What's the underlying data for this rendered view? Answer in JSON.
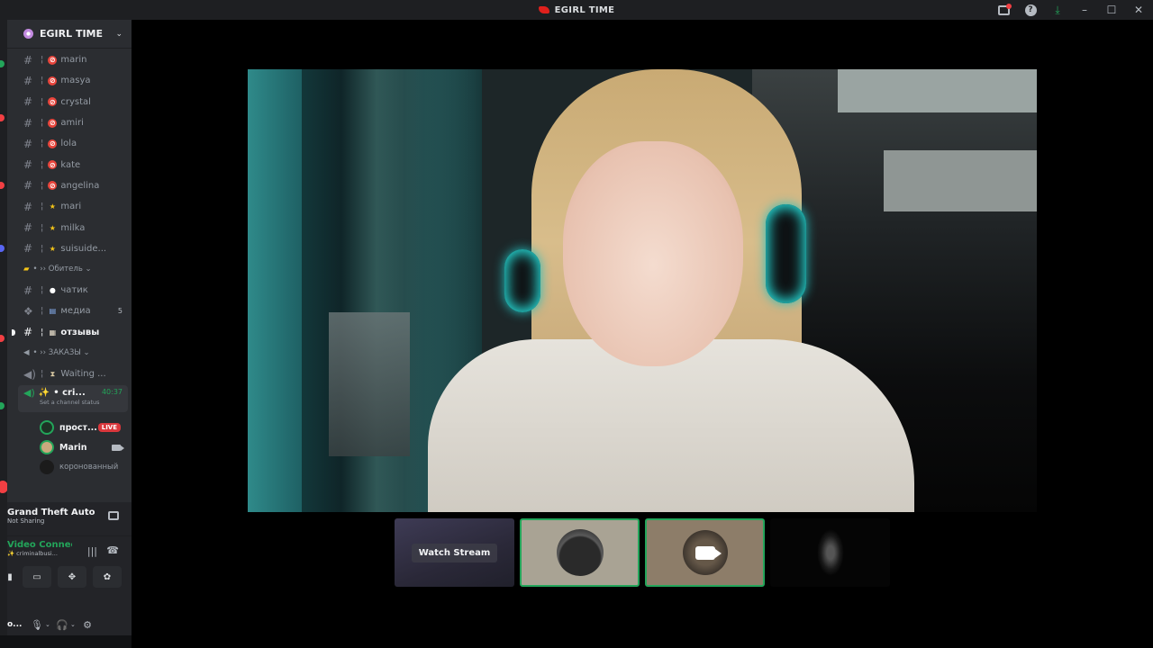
{
  "titlebar": {
    "title": "EGIRL TIME",
    "icons": [
      "inbox-icon",
      "help-icon",
      "download-icon",
      "minimize-icon",
      "maximize-icon",
      "close-icon"
    ]
  },
  "server": {
    "name": "EGIRL TIME"
  },
  "channels": [
    {
      "label": "marin",
      "emoji": "no-entry"
    },
    {
      "label": "masya",
      "emoji": "no-entry"
    },
    {
      "label": "crystal",
      "emoji": "no-entry"
    },
    {
      "label": "amiri",
      "emoji": "no-entry"
    },
    {
      "label": "lola",
      "emoji": "no-entry"
    },
    {
      "label": "kate",
      "emoji": "no-entry"
    },
    {
      "label": "angelina",
      "emoji": "no-entry"
    },
    {
      "label": "mari",
      "emoji": "star"
    },
    {
      "label": "milka",
      "emoji": "star"
    },
    {
      "label": "suisuide...",
      "emoji": "star"
    }
  ],
  "category_1": {
    "label": "• ›› Обитель ⌄"
  },
  "channels_2": [
    {
      "label": "чатик"
    },
    {
      "label": "медиа",
      "count": "5"
    },
    {
      "label": "отзывы"
    }
  ],
  "category_2": {
    "label": "• ›› ЗАКАЗЫ ⌄"
  },
  "voice_channels": [
    {
      "label": "Waiting ..."
    }
  ],
  "active_voice": {
    "label": "• cri...",
    "timer": "40:37",
    "status": "Set a channel status"
  },
  "voice_users": [
    {
      "name": "прост...",
      "badge": "LIVE"
    },
    {
      "name": "Marin"
    },
    {
      "name": "коронованный"
    }
  ],
  "activity": {
    "game": "Grand Theft Auto V...",
    "sub": "Not Sharing"
  },
  "voice_status": {
    "title": "Video Connected",
    "sub": "criminalbusi..."
  },
  "user": {
    "name": "o..."
  },
  "stream": {
    "watch_label": "Watch Stream"
  },
  "colors": {
    "accent_green": "#23a55a",
    "live_red": "#da373c",
    "sidebar_bg": "#2b2d31"
  }
}
